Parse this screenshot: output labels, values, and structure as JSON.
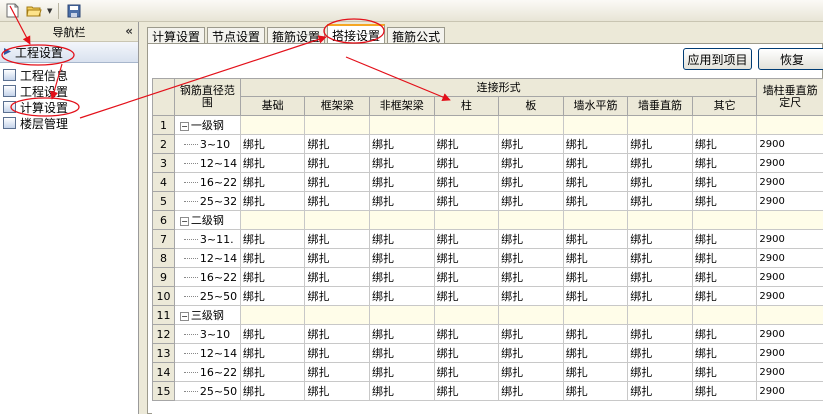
{
  "toolbar": {
    "icons": [
      "new-file-icon",
      "open-folder-icon",
      "dropdown-icon",
      "save-icon"
    ]
  },
  "nav": {
    "header": "导航栏",
    "collapse": "«",
    "section": "工程设置",
    "items": [
      {
        "label": "工程信息",
        "icon": "info-icon"
      },
      {
        "label": "工程设置",
        "icon": "settings-icon"
      },
      {
        "label": "计算设置",
        "icon": "calc-icon"
      },
      {
        "label": "楼层管理",
        "icon": "floors-icon"
      }
    ]
  },
  "tabs": [
    "计算设置",
    "节点设置",
    "箍筋设置",
    "搭接设置",
    "箍筋公式"
  ],
  "active_tab": "搭接设置",
  "buttons": {
    "apply": "应用到项目",
    "restore": "恢复"
  },
  "table": {
    "header_diam": "钢筋直径范围",
    "header_group": "连接形式",
    "header_last": "墙柱垂直筋定尺",
    "columns": [
      "基础",
      "框架梁",
      "非框架梁",
      "柱",
      "板",
      "墙水平筋",
      "墙垂直筋",
      "其它"
    ],
    "rows": [
      {
        "num": "1",
        "type": "group",
        "label": "一级钢"
      },
      {
        "num": "2",
        "type": "data",
        "label": "3~10",
        "values": [
          "绑扎",
          "绑扎",
          "绑扎",
          "绑扎",
          "绑扎",
          "绑扎",
          "绑扎",
          "绑扎"
        ],
        "length": "2900"
      },
      {
        "num": "3",
        "type": "data",
        "label": "12~14",
        "values": [
          "绑扎",
          "绑扎",
          "绑扎",
          "绑扎",
          "绑扎",
          "绑扎",
          "绑扎",
          "绑扎"
        ],
        "length": "2900"
      },
      {
        "num": "4",
        "type": "data",
        "label": "16~22",
        "values": [
          "绑扎",
          "绑扎",
          "绑扎",
          "绑扎",
          "绑扎",
          "绑扎",
          "绑扎",
          "绑扎"
        ],
        "length": "2900"
      },
      {
        "num": "5",
        "type": "data",
        "label": "25~32",
        "values": [
          "绑扎",
          "绑扎",
          "绑扎",
          "绑扎",
          "绑扎",
          "绑扎",
          "绑扎",
          "绑扎"
        ],
        "length": "2900"
      },
      {
        "num": "6",
        "type": "group",
        "label": "二级钢"
      },
      {
        "num": "7",
        "type": "data",
        "label": "3~11.",
        "values": [
          "绑扎",
          "绑扎",
          "绑扎",
          "绑扎",
          "绑扎",
          "绑扎",
          "绑扎",
          "绑扎"
        ],
        "length": "2900"
      },
      {
        "num": "8",
        "type": "data",
        "label": "12~14",
        "values": [
          "绑扎",
          "绑扎",
          "绑扎",
          "绑扎",
          "绑扎",
          "绑扎",
          "绑扎",
          "绑扎"
        ],
        "length": "2900"
      },
      {
        "num": "9",
        "type": "data",
        "label": "16~22",
        "values": [
          "绑扎",
          "绑扎",
          "绑扎",
          "绑扎",
          "绑扎",
          "绑扎",
          "绑扎",
          "绑扎"
        ],
        "length": "2900"
      },
      {
        "num": "10",
        "type": "data",
        "label": "25~50",
        "values": [
          "绑扎",
          "绑扎",
          "绑扎",
          "绑扎",
          "绑扎",
          "绑扎",
          "绑扎",
          "绑扎"
        ],
        "length": "2900"
      },
      {
        "num": "11",
        "type": "group",
        "label": "三级钢"
      },
      {
        "num": "12",
        "type": "data",
        "label": "3~10",
        "values": [
          "绑扎",
          "绑扎",
          "绑扎",
          "绑扎",
          "绑扎",
          "绑扎",
          "绑扎",
          "绑扎"
        ],
        "length": "2900"
      },
      {
        "num": "13",
        "type": "data",
        "label": "12~14",
        "values": [
          "绑扎",
          "绑扎",
          "绑扎",
          "绑扎",
          "绑扎",
          "绑扎",
          "绑扎",
          "绑扎"
        ],
        "length": "2900"
      },
      {
        "num": "14",
        "type": "data",
        "label": "16~22",
        "values": [
          "绑扎",
          "绑扎",
          "绑扎",
          "绑扎",
          "绑扎",
          "绑扎",
          "绑扎",
          "绑扎"
        ],
        "length": "2900"
      },
      {
        "num": "15",
        "type": "data",
        "label": "25~50",
        "values": [
          "绑扎",
          "绑扎",
          "绑扎",
          "绑扎",
          "绑扎",
          "绑扎",
          "绑扎",
          "绑扎"
        ],
        "length": "2900"
      }
    ]
  },
  "colors": {
    "annotation": "#e3101a",
    "active_tab_accent": "#f5a623",
    "group_row_bg": "#fffde9"
  }
}
